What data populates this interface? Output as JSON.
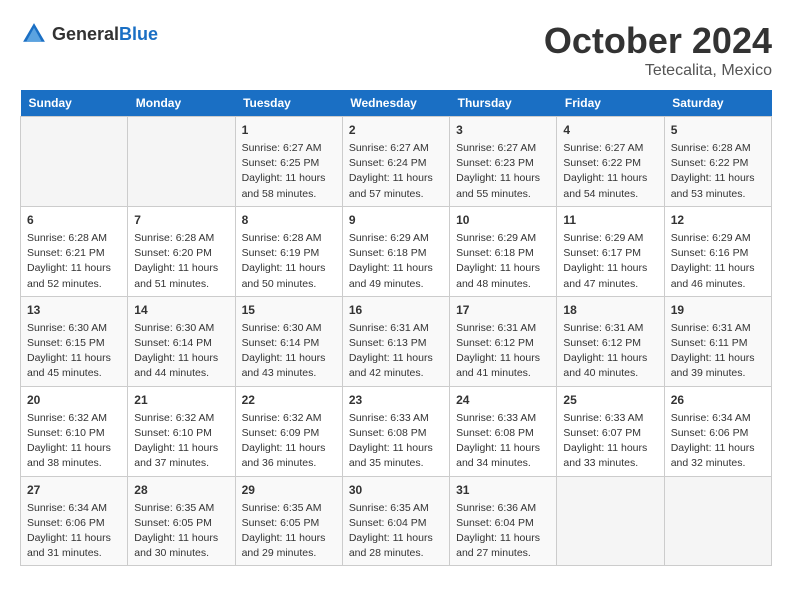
{
  "header": {
    "logo_general": "General",
    "logo_blue": "Blue",
    "month_title": "October 2024",
    "location": "Tetecalita, Mexico"
  },
  "weekdays": [
    "Sunday",
    "Monday",
    "Tuesday",
    "Wednesday",
    "Thursday",
    "Friday",
    "Saturday"
  ],
  "weeks": [
    [
      {
        "day": "",
        "sunrise": "",
        "sunset": "",
        "daylight": ""
      },
      {
        "day": "",
        "sunrise": "",
        "sunset": "",
        "daylight": ""
      },
      {
        "day": "1",
        "sunrise": "Sunrise: 6:27 AM",
        "sunset": "Sunset: 6:25 PM",
        "daylight": "Daylight: 11 hours and 58 minutes."
      },
      {
        "day": "2",
        "sunrise": "Sunrise: 6:27 AM",
        "sunset": "Sunset: 6:24 PM",
        "daylight": "Daylight: 11 hours and 57 minutes."
      },
      {
        "day": "3",
        "sunrise": "Sunrise: 6:27 AM",
        "sunset": "Sunset: 6:23 PM",
        "daylight": "Daylight: 11 hours and 55 minutes."
      },
      {
        "day": "4",
        "sunrise": "Sunrise: 6:27 AM",
        "sunset": "Sunset: 6:22 PM",
        "daylight": "Daylight: 11 hours and 54 minutes."
      },
      {
        "day": "5",
        "sunrise": "Sunrise: 6:28 AM",
        "sunset": "Sunset: 6:22 PM",
        "daylight": "Daylight: 11 hours and 53 minutes."
      }
    ],
    [
      {
        "day": "6",
        "sunrise": "Sunrise: 6:28 AM",
        "sunset": "Sunset: 6:21 PM",
        "daylight": "Daylight: 11 hours and 52 minutes."
      },
      {
        "day": "7",
        "sunrise": "Sunrise: 6:28 AM",
        "sunset": "Sunset: 6:20 PM",
        "daylight": "Daylight: 11 hours and 51 minutes."
      },
      {
        "day": "8",
        "sunrise": "Sunrise: 6:28 AM",
        "sunset": "Sunset: 6:19 PM",
        "daylight": "Daylight: 11 hours and 50 minutes."
      },
      {
        "day": "9",
        "sunrise": "Sunrise: 6:29 AM",
        "sunset": "Sunset: 6:18 PM",
        "daylight": "Daylight: 11 hours and 49 minutes."
      },
      {
        "day": "10",
        "sunrise": "Sunrise: 6:29 AM",
        "sunset": "Sunset: 6:18 PM",
        "daylight": "Daylight: 11 hours and 48 minutes."
      },
      {
        "day": "11",
        "sunrise": "Sunrise: 6:29 AM",
        "sunset": "Sunset: 6:17 PM",
        "daylight": "Daylight: 11 hours and 47 minutes."
      },
      {
        "day": "12",
        "sunrise": "Sunrise: 6:29 AM",
        "sunset": "Sunset: 6:16 PM",
        "daylight": "Daylight: 11 hours and 46 minutes."
      }
    ],
    [
      {
        "day": "13",
        "sunrise": "Sunrise: 6:30 AM",
        "sunset": "Sunset: 6:15 PM",
        "daylight": "Daylight: 11 hours and 45 minutes."
      },
      {
        "day": "14",
        "sunrise": "Sunrise: 6:30 AM",
        "sunset": "Sunset: 6:14 PM",
        "daylight": "Daylight: 11 hours and 44 minutes."
      },
      {
        "day": "15",
        "sunrise": "Sunrise: 6:30 AM",
        "sunset": "Sunset: 6:14 PM",
        "daylight": "Daylight: 11 hours and 43 minutes."
      },
      {
        "day": "16",
        "sunrise": "Sunrise: 6:31 AM",
        "sunset": "Sunset: 6:13 PM",
        "daylight": "Daylight: 11 hours and 42 minutes."
      },
      {
        "day": "17",
        "sunrise": "Sunrise: 6:31 AM",
        "sunset": "Sunset: 6:12 PM",
        "daylight": "Daylight: 11 hours and 41 minutes."
      },
      {
        "day": "18",
        "sunrise": "Sunrise: 6:31 AM",
        "sunset": "Sunset: 6:12 PM",
        "daylight": "Daylight: 11 hours and 40 minutes."
      },
      {
        "day": "19",
        "sunrise": "Sunrise: 6:31 AM",
        "sunset": "Sunset: 6:11 PM",
        "daylight": "Daylight: 11 hours and 39 minutes."
      }
    ],
    [
      {
        "day": "20",
        "sunrise": "Sunrise: 6:32 AM",
        "sunset": "Sunset: 6:10 PM",
        "daylight": "Daylight: 11 hours and 38 minutes."
      },
      {
        "day": "21",
        "sunrise": "Sunrise: 6:32 AM",
        "sunset": "Sunset: 6:10 PM",
        "daylight": "Daylight: 11 hours and 37 minutes."
      },
      {
        "day": "22",
        "sunrise": "Sunrise: 6:32 AM",
        "sunset": "Sunset: 6:09 PM",
        "daylight": "Daylight: 11 hours and 36 minutes."
      },
      {
        "day": "23",
        "sunrise": "Sunrise: 6:33 AM",
        "sunset": "Sunset: 6:08 PM",
        "daylight": "Daylight: 11 hours and 35 minutes."
      },
      {
        "day": "24",
        "sunrise": "Sunrise: 6:33 AM",
        "sunset": "Sunset: 6:08 PM",
        "daylight": "Daylight: 11 hours and 34 minutes."
      },
      {
        "day": "25",
        "sunrise": "Sunrise: 6:33 AM",
        "sunset": "Sunset: 6:07 PM",
        "daylight": "Daylight: 11 hours and 33 minutes."
      },
      {
        "day": "26",
        "sunrise": "Sunrise: 6:34 AM",
        "sunset": "Sunset: 6:06 PM",
        "daylight": "Daylight: 11 hours and 32 minutes."
      }
    ],
    [
      {
        "day": "27",
        "sunrise": "Sunrise: 6:34 AM",
        "sunset": "Sunset: 6:06 PM",
        "daylight": "Daylight: 11 hours and 31 minutes."
      },
      {
        "day": "28",
        "sunrise": "Sunrise: 6:35 AM",
        "sunset": "Sunset: 6:05 PM",
        "daylight": "Daylight: 11 hours and 30 minutes."
      },
      {
        "day": "29",
        "sunrise": "Sunrise: 6:35 AM",
        "sunset": "Sunset: 6:05 PM",
        "daylight": "Daylight: 11 hours and 29 minutes."
      },
      {
        "day": "30",
        "sunrise": "Sunrise: 6:35 AM",
        "sunset": "Sunset: 6:04 PM",
        "daylight": "Daylight: 11 hours and 28 minutes."
      },
      {
        "day": "31",
        "sunrise": "Sunrise: 6:36 AM",
        "sunset": "Sunset: 6:04 PM",
        "daylight": "Daylight: 11 hours and 27 minutes."
      },
      {
        "day": "",
        "sunrise": "",
        "sunset": "",
        "daylight": ""
      },
      {
        "day": "",
        "sunrise": "",
        "sunset": "",
        "daylight": ""
      }
    ]
  ]
}
